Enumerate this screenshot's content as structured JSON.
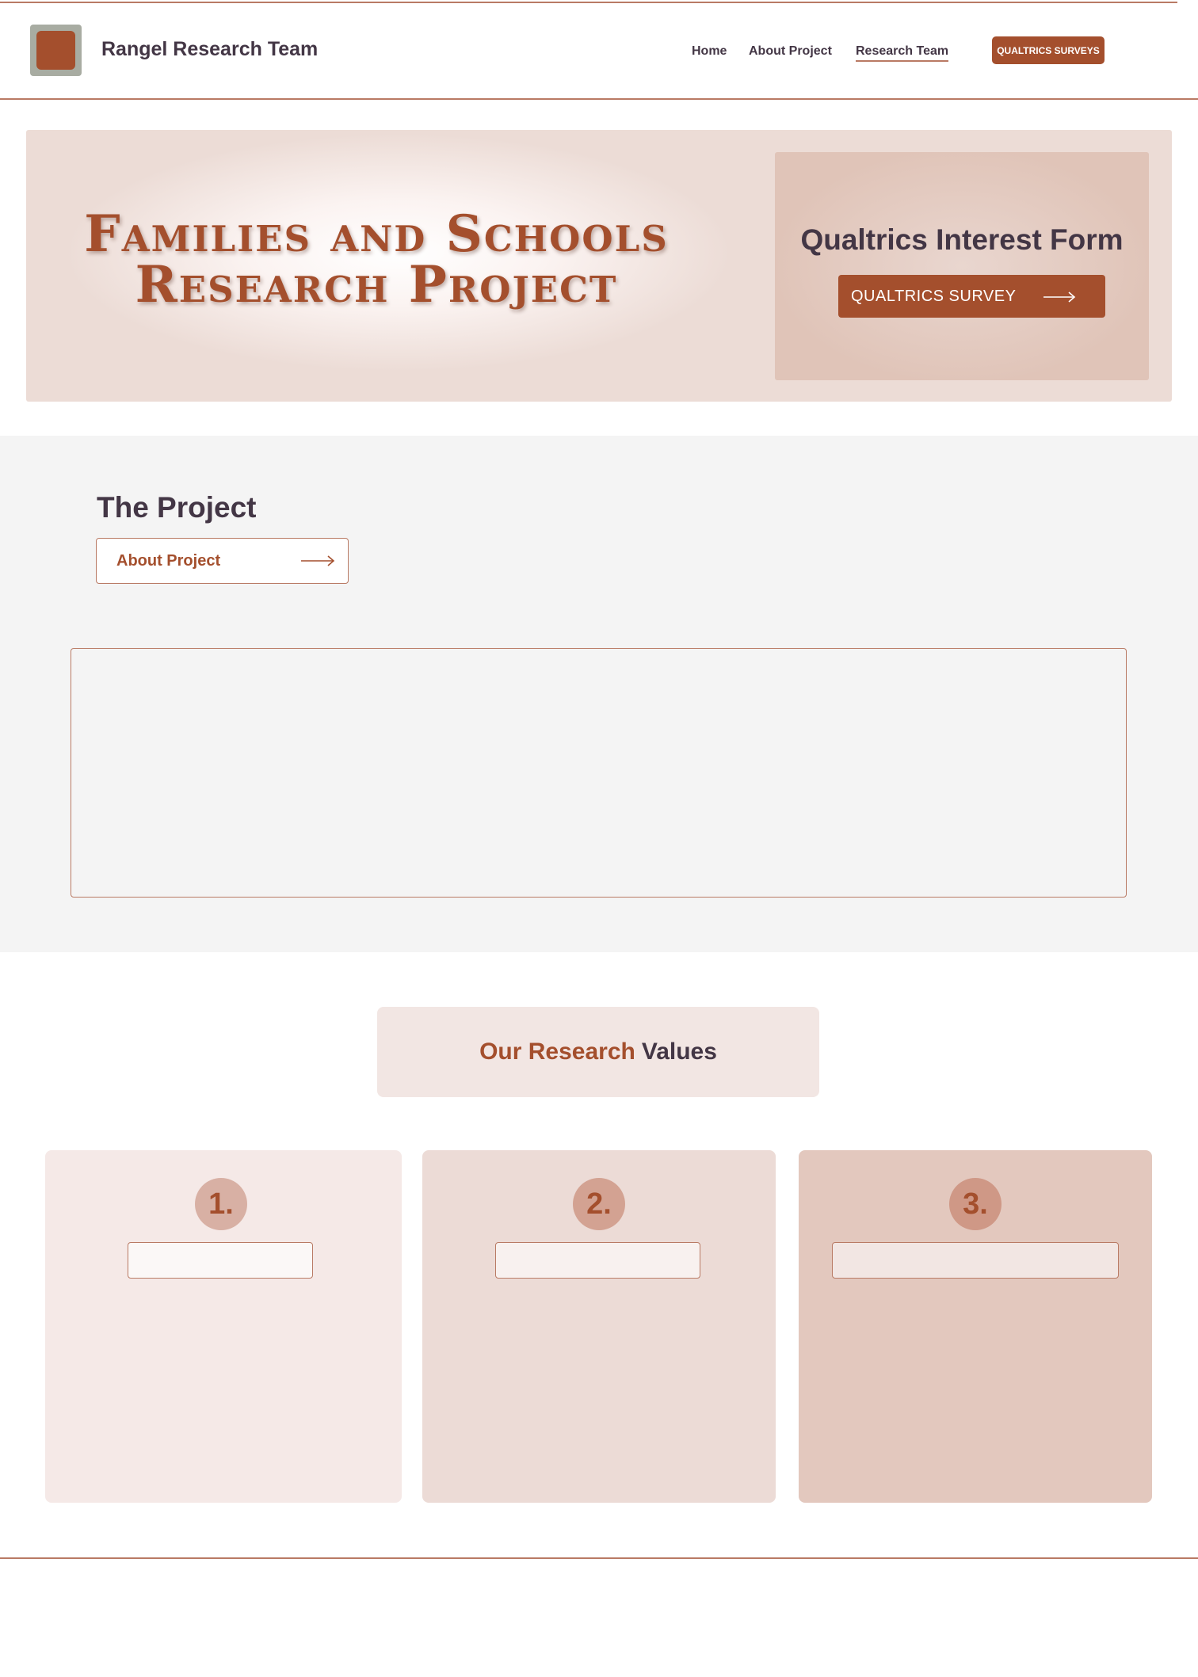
{
  "header": {
    "brand": "Rangel Research Team",
    "nav": {
      "home": "Home",
      "about": "About Project",
      "team": "Research Team"
    },
    "cta_label": "QUALTRICS SURVEYS"
  },
  "hero": {
    "title_line1": "Families and Schools",
    "title_line2": "Research Project",
    "form_title": "Qualtrics Interest Form",
    "survey_button_label": "QUALTRICS SURVEY"
  },
  "project": {
    "title": "The Project",
    "about_button_label": "About Project"
  },
  "values": {
    "title_highlight": "Our Research",
    "title_rest": "Values",
    "cards": [
      {
        "number": "1."
      },
      {
        "number": "2."
      },
      {
        "number": "3."
      }
    ]
  },
  "colors": {
    "accent": "#a44f2d",
    "text": "#433645",
    "line": "#b97a64",
    "section_bg": "#f4f4f4"
  },
  "icons": {
    "arrow": "arrow-right-icon",
    "logo": "logo-icon"
  }
}
